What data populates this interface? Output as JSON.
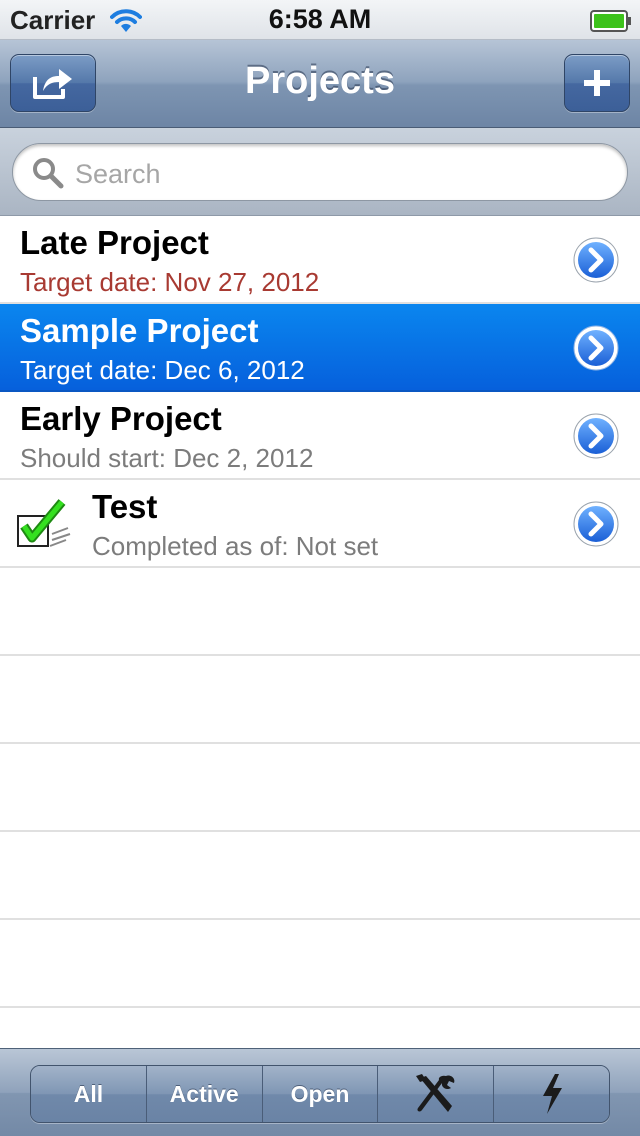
{
  "status_bar": {
    "carrier": "Carrier",
    "time": "6:58 AM"
  },
  "nav": {
    "title": "Projects",
    "left_button_icon": "share-icon",
    "right_button_icon": "plus-icon"
  },
  "search": {
    "placeholder": "Search"
  },
  "projects": [
    {
      "title": "Late Project",
      "subtitle": "Target date: Nov 27, 2012",
      "subtitle_color": "#a83a32",
      "selected": false,
      "icon": null
    },
    {
      "title": "Sample Project",
      "subtitle": "Target date: Dec 6, 2012",
      "selected": true,
      "icon": null
    },
    {
      "title": "Early Project",
      "subtitle": "Should start: Dec 2, 2012",
      "selected": false,
      "icon": null
    },
    {
      "title": "Test",
      "subtitle": "Completed as of: Not set",
      "selected": false,
      "icon": "completed-check-icon"
    }
  ],
  "tab_bar": {
    "segments": [
      {
        "label": "All"
      },
      {
        "label": "Active"
      },
      {
        "label": "Open"
      },
      {
        "icon": "tools-icon"
      },
      {
        "icon": "lightning-icon"
      }
    ]
  },
  "colors": {
    "selection_blue": "#0660dc",
    "late_red": "#a83a32",
    "nav_blue": "#6d85a5"
  }
}
